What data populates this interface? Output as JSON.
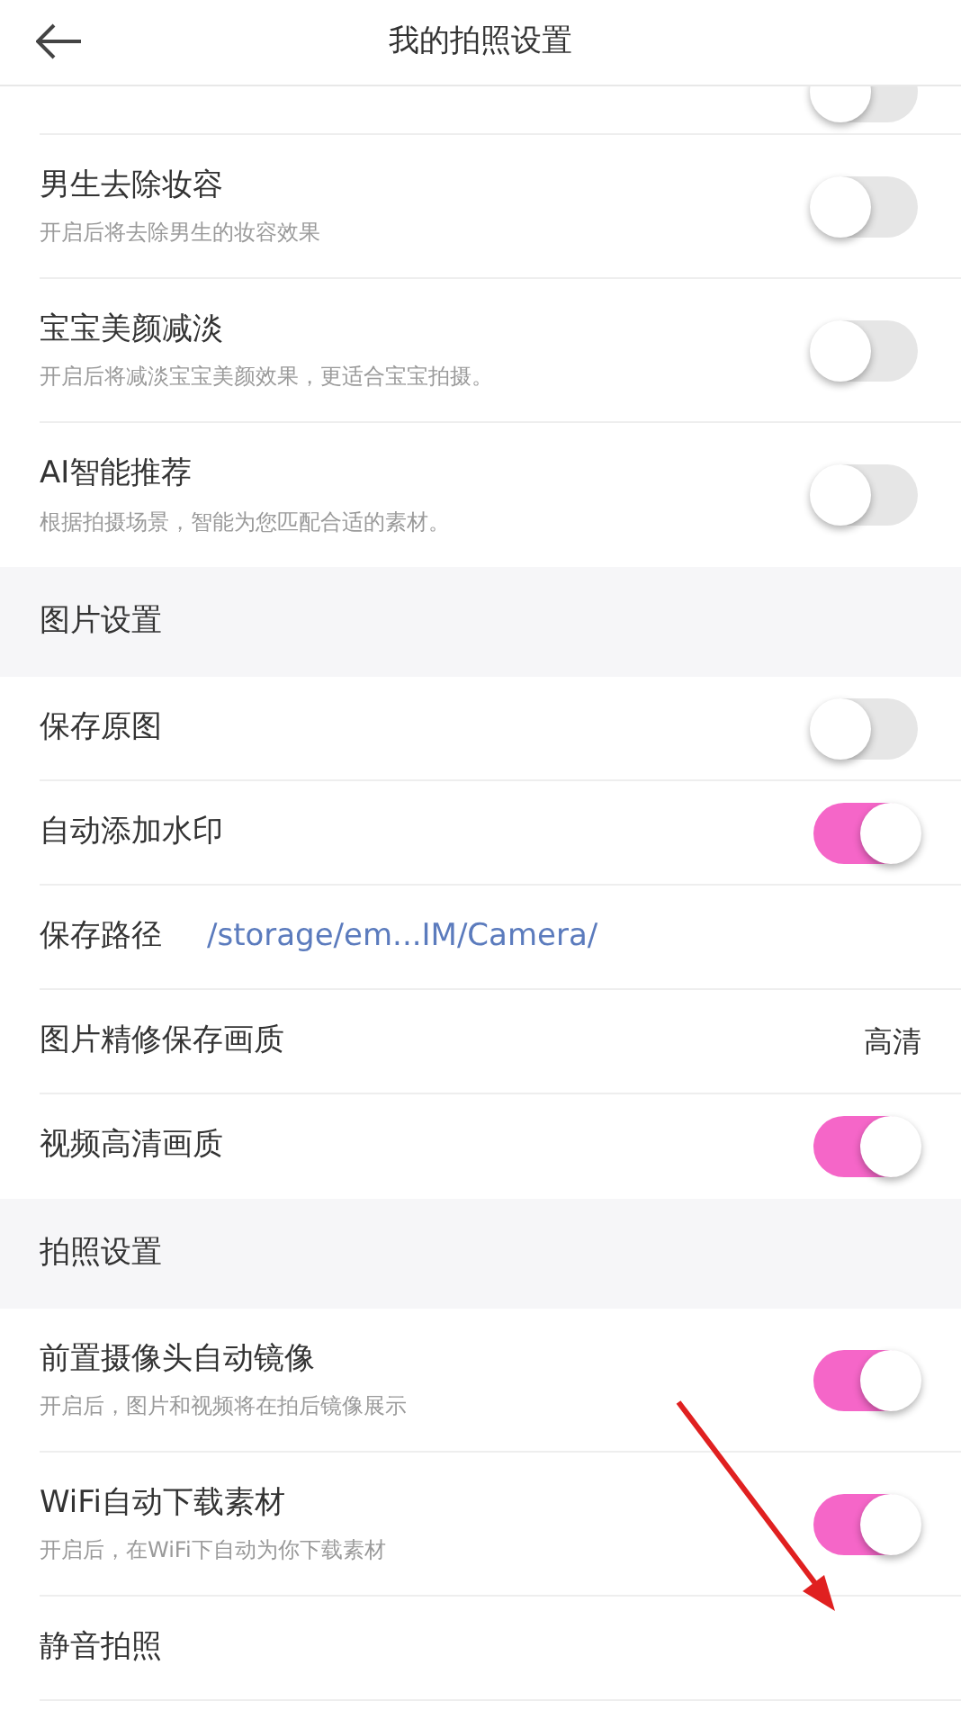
{
  "header": {
    "title": "我的拍照设置"
  },
  "sections": [
    {
      "rows": [
        {
          "kind": "partial",
          "on": false
        },
        {
          "kind": "toggle",
          "label": "男生去除妆容",
          "subtitle": "开启后将去除男生的妆容效果",
          "on": false
        },
        {
          "kind": "toggle",
          "label": "宝宝美颜减淡",
          "subtitle": "开启后将减淡宝宝美颜效果，更适合宝宝拍摄。",
          "on": false
        },
        {
          "kind": "toggle",
          "label": "AI智能推荐",
          "subtitle": "根据拍摄场景，智能为您匹配合适的素材。",
          "on": false
        }
      ]
    },
    {
      "title": "图片设置",
      "rows": [
        {
          "kind": "toggle",
          "label": "保存原图",
          "on": false
        },
        {
          "kind": "toggle",
          "label": "自动添加水印",
          "on": true
        },
        {
          "kind": "path",
          "label": "保存路径",
          "value": "/storage/em...IM/Camera/"
        },
        {
          "kind": "value",
          "label": "图片精修保存画质",
          "value": "高清"
        },
        {
          "kind": "toggle",
          "label": "视频高清画质",
          "on": true
        }
      ]
    },
    {
      "title": "拍照设置",
      "rows": [
        {
          "kind": "toggle",
          "label": "前置摄像头自动镜像",
          "subtitle": "开启后，图片和视频将在拍后镜像展示",
          "on": true
        },
        {
          "kind": "toggle",
          "label": "WiFi自动下载素材",
          "subtitle": "开启后，在WiFi下自动为你下载素材",
          "on": true
        },
        {
          "kind": "plain",
          "label": "静音拍照"
        }
      ]
    }
  ]
}
